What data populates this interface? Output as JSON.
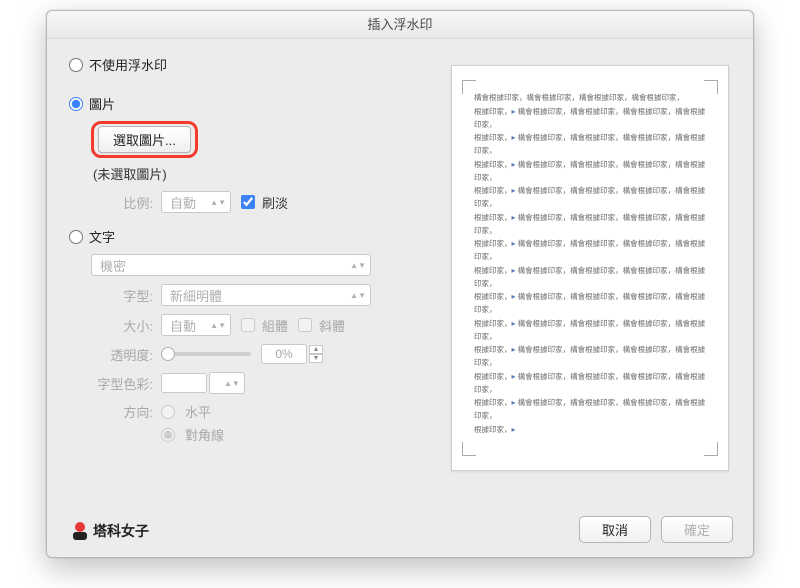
{
  "dialog": {
    "title": "插入浮水印"
  },
  "options": {
    "none": {
      "label": "不使用浮水印",
      "checked": false
    },
    "picture": {
      "label": "圖片",
      "checked": true,
      "select_button": "選取圖片...",
      "status": "(未選取圖片)",
      "scale_label": "比例:",
      "scale_value": "自動",
      "washout_label": "刷淡",
      "washout_checked": true
    },
    "text": {
      "label": "文字",
      "checked": false,
      "preset_value": "機密",
      "font_label": "字型:",
      "font_value": "新細明體",
      "size_label": "大小:",
      "size_value": "自動",
      "bold_label": "組體",
      "bold_checked": false,
      "italic_label": "斜體",
      "italic_checked": false,
      "transparency_label": "透明度:",
      "transparency_value": "0%",
      "fontcolor_label": "字型色彩:",
      "orientation_label": "方向:",
      "orientation_horizontal": "水平",
      "orientation_diagonal": "對角線",
      "orientation_value": "diagonal"
    }
  },
  "preview": {
    "sample_unit": "構會根據印家，",
    "marker": "▸"
  },
  "buttons": {
    "cancel": "取消",
    "ok": "確定"
  },
  "brand": {
    "name": "塔科女子"
  }
}
